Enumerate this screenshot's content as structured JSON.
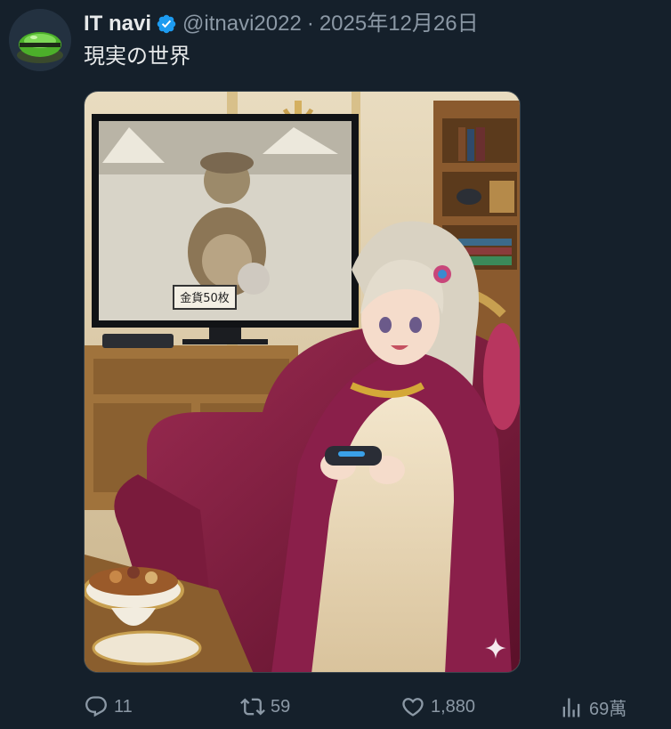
{
  "author": {
    "display_name": "IT navi",
    "handle": "@itnavi2022",
    "separator": "·",
    "date": "2025年12月26日",
    "verified": true,
    "avatar_icon": "green-slime-avatar"
  },
  "post": {
    "text": "現実の世界",
    "image": {
      "description_icon": "anime-illustration-image",
      "sign_text": "金貨50枚"
    }
  },
  "actions": {
    "replies": "11",
    "reposts": "59",
    "likes": "1,880",
    "views": "69萬"
  },
  "colors": {
    "background": "#15202b",
    "primary_text": "#e7e9ea",
    "secondary_text": "#8b98a5",
    "verified_blue": "#1d9bf0"
  }
}
